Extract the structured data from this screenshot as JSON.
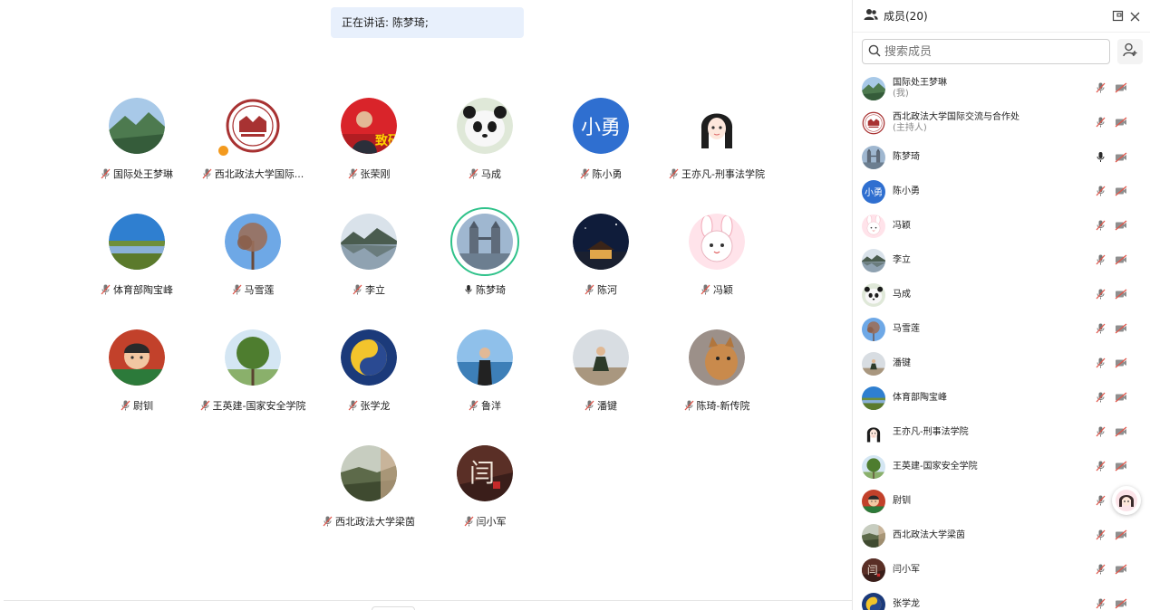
{
  "speaking_label": "正在讲话: 陈梦琦;",
  "panel": {
    "title": "成员(20)",
    "search_placeholder": "搜索成员"
  },
  "colors": {
    "accent": "#2f6fd0",
    "speaking_ring": "#2fc28a",
    "muted_red": "#e0554a",
    "host_badge": "#f39a1e"
  },
  "stage_participants": [
    {
      "name": "国际处王梦琳",
      "avatar": "landscape-mountain",
      "muted": true
    },
    {
      "name": "西北政法大学国际...",
      "avatar": "university-seal",
      "muted": true,
      "host": true
    },
    {
      "name": "张荣刚",
      "avatar": "person-red-backdrop",
      "muted": true
    },
    {
      "name": "马成",
      "avatar": "panda",
      "muted": true
    },
    {
      "name": "陈小勇",
      "avatar_text": "小勇",
      "avatar": "text-blue",
      "muted": true
    },
    {
      "name": "王亦凡-刑事法学院",
      "avatar": "cartoon-girl",
      "muted": true
    },
    {
      "name": "体育部陶宝峰",
      "avatar": "landscape-grassland",
      "muted": true
    },
    {
      "name": "马雪莲",
      "avatar": "tree-sky",
      "muted": true
    },
    {
      "name": "李立",
      "avatar": "landscape-lake",
      "muted": true
    },
    {
      "name": "陈梦琦",
      "avatar": "tower-bridge",
      "muted": false,
      "speaking": true
    },
    {
      "name": "陈河",
      "avatar": "night-temple",
      "muted": true
    },
    {
      "name": "冯颖",
      "avatar": "cartoon-bunny",
      "muted": true
    },
    {
      "name": "尉钏",
      "avatar": "cartoon-boy",
      "muted": true
    },
    {
      "name": "王英建-国家安全学院",
      "avatar": "tree-green",
      "muted": true
    },
    {
      "name": "张学龙",
      "avatar": "taiji",
      "muted": true
    },
    {
      "name": "鲁洋",
      "avatar": "person-seaside",
      "muted": true
    },
    {
      "name": "潘键",
      "avatar": "person-sitting",
      "muted": true
    },
    {
      "name": "陈琦-新传院",
      "avatar": "cat",
      "muted": true
    },
    {
      "name": "西北政法大学梁茵",
      "avatar": "landscape-hills",
      "muted": true
    },
    {
      "name": "闫小军",
      "avatar": "calligraphy",
      "muted": true
    }
  ],
  "members": [
    {
      "name": "国际处王梦琳",
      "sub": "(我)",
      "avatar": "landscape-mountain",
      "mic": "off"
    },
    {
      "name": "西北政法大学国际交流与合作处",
      "sub": "(主持人)",
      "avatar": "university-seal",
      "mic": "off"
    },
    {
      "name": "陈梦琦",
      "avatar": "tower-bridge",
      "mic": "on"
    },
    {
      "name": "陈小勇",
      "avatar_text": "小勇",
      "avatar": "text-blue",
      "mic": "off"
    },
    {
      "name": "冯颖",
      "avatar": "cartoon-bunny",
      "mic": "off"
    },
    {
      "name": "李立",
      "avatar": "landscape-lake",
      "mic": "off"
    },
    {
      "name": "马成",
      "avatar": "panda",
      "mic": "off"
    },
    {
      "name": "马雪莲",
      "avatar": "tree-sky",
      "mic": "off"
    },
    {
      "name": "潘键",
      "avatar": "person-sitting",
      "mic": "off"
    },
    {
      "name": "体育部陶宝峰",
      "avatar": "landscape-grassland",
      "mic": "off"
    },
    {
      "name": "王亦凡-刑事法学院",
      "avatar": "cartoon-girl",
      "mic": "off"
    },
    {
      "name": "王英建-国家安全学院",
      "avatar": "tree-green",
      "mic": "off"
    },
    {
      "name": "尉钏",
      "avatar": "cartoon-boy",
      "mic": "off"
    },
    {
      "name": "西北政法大学梁茵",
      "avatar": "landscape-hills",
      "mic": "off"
    },
    {
      "name": "闫小军",
      "avatar": "calligraphy",
      "mic": "off"
    },
    {
      "name": "张学龙",
      "avatar": "taiji",
      "mic": "off"
    }
  ]
}
